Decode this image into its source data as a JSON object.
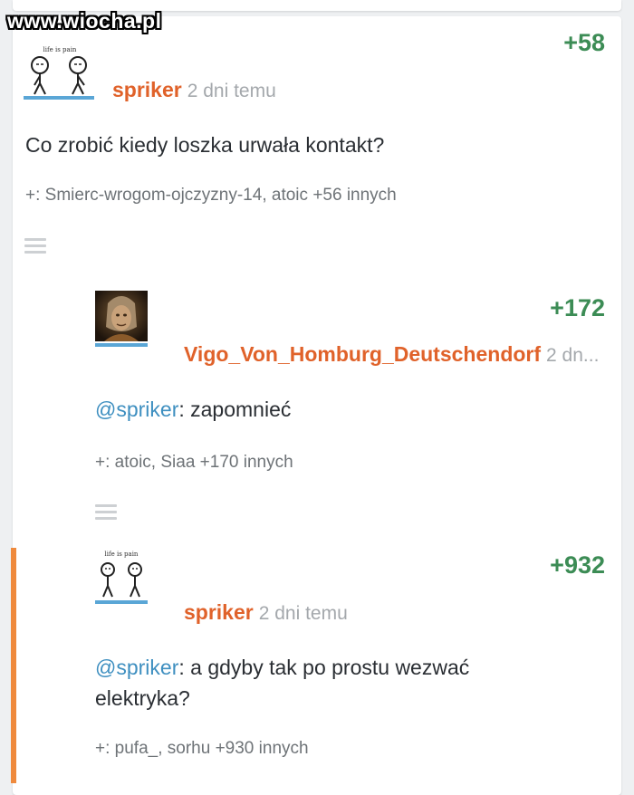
{
  "watermark": "www.wiocha.pl",
  "colors": {
    "score": "#3c8c55",
    "author": "#e0622a",
    "mention": "#3e8fc0",
    "thread_bar": "#ef8a3d",
    "avatar_underline": "#5aa6d6"
  },
  "comments": [
    {
      "score": "+58",
      "avatar_caption": "life is pain",
      "author": "spriker",
      "time": "2 dni temu",
      "text": "Co zrobić kiedy loszka urwała kontakt?",
      "voters_prefix": "+:",
      "voters_names": "Smierc-wrogom-ojczyzny-14",
      "voters_sep": ",",
      "voters_name2": "atoic",
      "voters_rest": "+56 innych"
    },
    {
      "score": "+172",
      "author": "Vigo_Von_Homburg_Deutschendorf",
      "time": "2 dn...",
      "mention": "@spriker",
      "text": ": zapomnieć",
      "voters_prefix": "+:",
      "voters_names": "atoic",
      "voters_sep": ",",
      "voters_name2": "Siaa",
      "voters_rest": "+170 innych"
    },
    {
      "score": "+932",
      "avatar_caption": "life is pain",
      "author": "spriker",
      "time": "2 dni temu",
      "mention": "@spriker",
      "text_line1": ": a gdyby tak po prostu wezwać",
      "text_line2": "elektryka?",
      "voters_prefix": "+:",
      "voters_names": "pufa_",
      "voters_sep": ",",
      "voters_name2": "sorhu",
      "voters_rest": "+930 innych"
    }
  ]
}
